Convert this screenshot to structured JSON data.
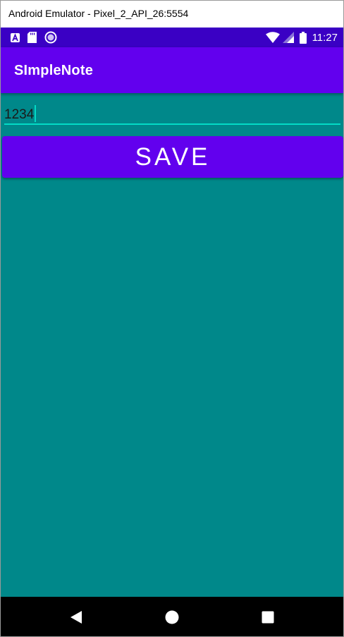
{
  "window": {
    "title": "Android Emulator - Pixel_2_API_26:5554"
  },
  "status_bar": {
    "background": "#3a00c4",
    "left_icons": [
      "a-notification-icon",
      "sd-card-icon",
      "circle-sync-icon"
    ],
    "right_icons": [
      "wifi-icon",
      "cell-signal-icon",
      "battery-icon"
    ],
    "time": "11:27"
  },
  "app_bar": {
    "title": "SImpleNote",
    "background": "#6200ee"
  },
  "note_input": {
    "value": "1234",
    "underline_color": "#03dac5"
  },
  "save_button": {
    "label": "SAVE",
    "background": "#6200ee"
  },
  "content": {
    "background": "#00888a"
  },
  "nav_bar": {
    "buttons": [
      "back-icon",
      "home-icon",
      "recents-icon"
    ]
  }
}
